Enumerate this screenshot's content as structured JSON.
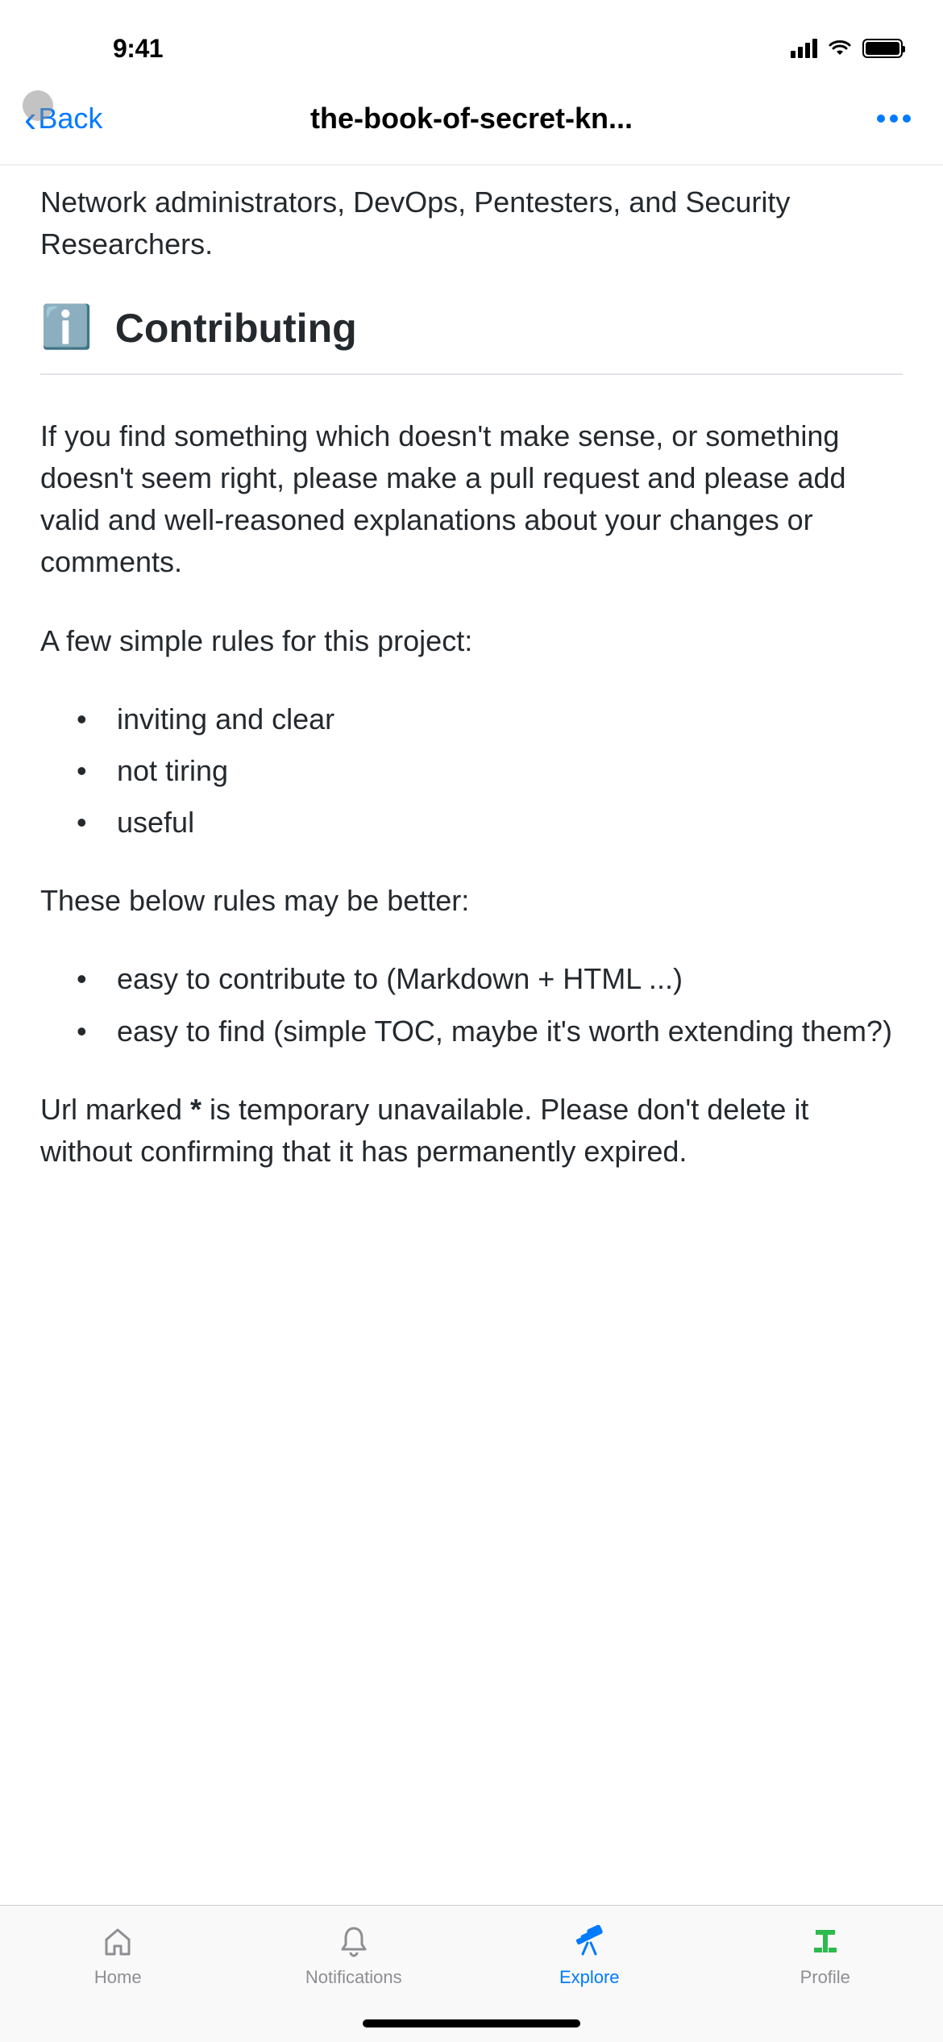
{
  "status": {
    "time": "9:41"
  },
  "nav": {
    "back_label": "Back",
    "title": "the-book-of-secret-kn...",
    "more_label": "More"
  },
  "content": {
    "intro": "Network administrators, DevOps, Pentesters, and Security Researchers.",
    "section_emoji": "ℹ️",
    "section_title": "Contributing",
    "para1": "If you find something which doesn't make sense, or something doesn't seem right, please make a pull request and please add valid and well-reasoned explanations about your changes or comments.",
    "para2": "A few simple rules for this project:",
    "list1": [
      "inviting and clear",
      "not tiring",
      "useful"
    ],
    "para3": "These below rules may be better:",
    "list2": [
      "easy to contribute to (Markdown + HTML ...)",
      "easy to find (simple TOC, maybe it's worth extending them?)"
    ],
    "para4_pre": "Url marked ",
    "para4_star": "*",
    "para4_post": " is temporary unavailable. Please don't delete it without confirming that it has permanently expired."
  },
  "tabs": {
    "home": "Home",
    "notifications": "Notifications",
    "explore": "Explore",
    "profile": "Profile"
  },
  "colors": {
    "accent": "#007aff",
    "green": "#2dba4e",
    "gray": "#8e8e93"
  }
}
